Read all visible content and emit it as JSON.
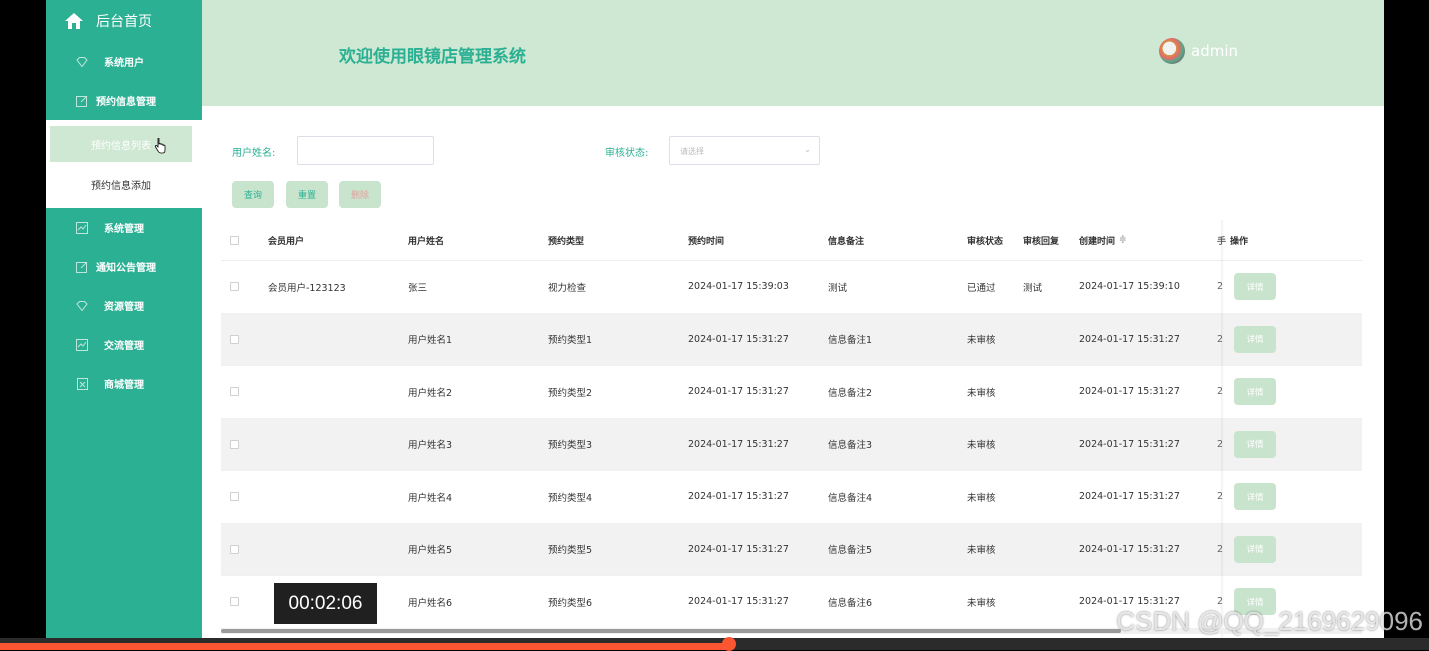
{
  "sidebar": {
    "home_label": "后台首页",
    "items": [
      {
        "label": "系统用户",
        "icon": "diamond-icon"
      },
      {
        "label": "预约信息管理",
        "icon": "edit-icon"
      }
    ],
    "submenu": [
      {
        "label": "预约信息列表",
        "active": true
      },
      {
        "label": "预约信息添加",
        "active": false
      }
    ],
    "items_after": [
      {
        "label": "系统管理",
        "icon": "chart-icon"
      },
      {
        "label": "通知公告管理",
        "icon": "edit-icon"
      },
      {
        "label": "资源管理",
        "icon": "diamond-icon"
      },
      {
        "label": "交流管理",
        "icon": "chart-icon"
      },
      {
        "label": "商城管理",
        "icon": "box-icon"
      }
    ]
  },
  "header": {
    "title": "欢迎使用眼镜店管理系统",
    "username": "admin"
  },
  "filters": {
    "name_label": "用户姓名:",
    "name_value": "",
    "status_label": "审核状态:",
    "status_placeholder": "请选择"
  },
  "buttons": {
    "search": "查询",
    "reset": "重置",
    "delete": "删除"
  },
  "table": {
    "columns": [
      "会员用户",
      "用户姓名",
      "预约类型",
      "预约时间",
      "信息备注",
      "审核状态",
      "审核回复",
      "创建时间",
      "操作"
    ],
    "sort_indicator": "≑",
    "rows": [
      {
        "member": "会员用户-123123",
        "name": "张三",
        "type": "视力检查",
        "time": "2024-01-17 15:39:03",
        "note": "测试",
        "status": "已通过",
        "reply": "测试",
        "created": "2024-01-17 15:39:10"
      },
      {
        "member": "",
        "name": "用户姓名1",
        "type": "预约类型1",
        "time": "2024-01-17 15:31:27",
        "note": "信息备注1",
        "status": "未审核",
        "reply": "",
        "created": "2024-01-17 15:31:27"
      },
      {
        "member": "",
        "name": "用户姓名2",
        "type": "预约类型2",
        "time": "2024-01-17 15:31:27",
        "note": "信息备注2",
        "status": "未审核",
        "reply": "",
        "created": "2024-01-17 15:31:27"
      },
      {
        "member": "",
        "name": "用户姓名3",
        "type": "预约类型3",
        "time": "2024-01-17 15:31:27",
        "note": "信息备注3",
        "status": "未审核",
        "reply": "",
        "created": "2024-01-17 15:31:27"
      },
      {
        "member": "",
        "name": "用户姓名4",
        "type": "预约类型4",
        "time": "2024-01-17 15:31:27",
        "note": "信息备注4",
        "status": "未审核",
        "reply": "",
        "created": "2024-01-17 15:31:27"
      },
      {
        "member": "",
        "name": "用户姓名5",
        "type": "预约类型5",
        "time": "2024-01-17 15:31:27",
        "note": "信息备注5",
        "status": "未审核",
        "reply": "",
        "created": "2024-01-17 15:31:27"
      },
      {
        "member": "",
        "name": "用户姓名6",
        "type": "预约类型6",
        "time": "2024-01-17 15:31:27",
        "note": "信息备注6",
        "status": "未审核",
        "reply": "",
        "created": "2024-01-17 15:31:27"
      }
    ],
    "detail_label": "详情",
    "truncated_mark": "2",
    "truncated_header_mark": "手"
  },
  "video": {
    "timestamp": "00:02:06",
    "progress": 0.51,
    "watermark": "CSDN @QQ_2169629096"
  },
  "colors": {
    "primary": "#2bb094",
    "header_bg": "#cfe8d3",
    "button_bg": "#c9e4cd",
    "progress": "#fc5531"
  }
}
